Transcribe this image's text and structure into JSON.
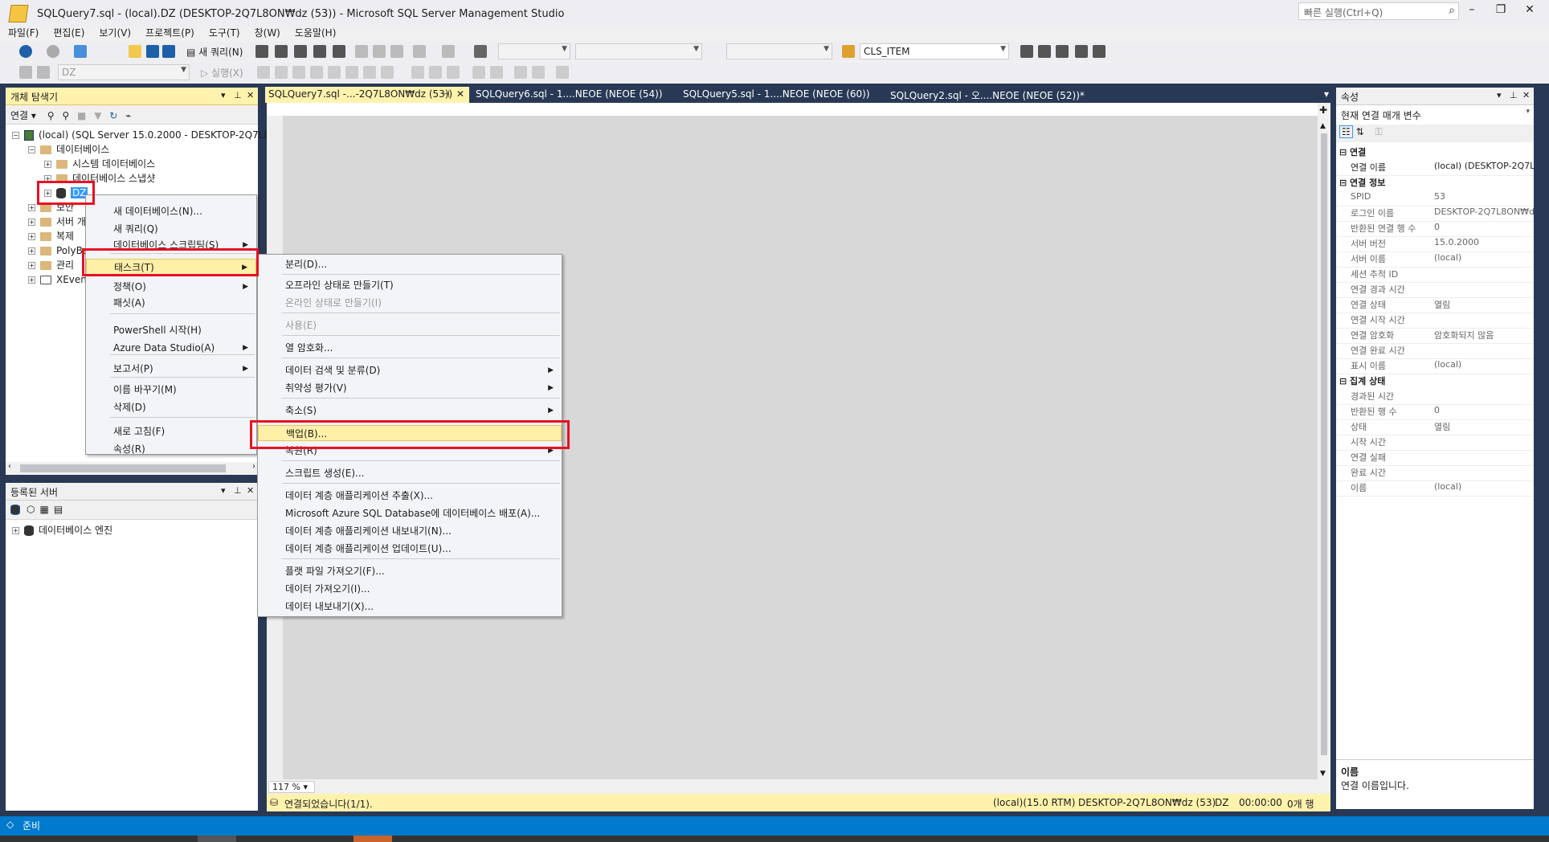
{
  "window": {
    "title": "SQLQuery7.sql - (local).DZ (DESKTOP-2Q7L8ON₩dz (53)) - Microsoft SQL Server Management Studio",
    "quick_launch": "빠른 실행(Ctrl+Q)"
  },
  "menubar": [
    "파일(F)",
    "편집(E)",
    "보기(V)",
    "프로젝트(P)",
    "도구(T)",
    "창(W)",
    "도움말(H)"
  ],
  "toolbar": {
    "new_query": "새 쿼리(N)",
    "db_combo": "DZ",
    "execute": "실행(X)",
    "find_combo": "CLS_ITEM"
  },
  "object_explorer": {
    "title": "개체 탐색기",
    "connect": "연결",
    "nodes": [
      {
        "label": "(local) (SQL Server 15.0.2000 - DESKTOP-2Q7L8C"
      },
      {
        "label": "데이터베이스"
      },
      {
        "label": "시스템 데이터베이스"
      },
      {
        "label": "데이터베이스 스냅샷"
      },
      {
        "label": "DZ"
      },
      {
        "label": "보안"
      },
      {
        "label": "서버 개체"
      },
      {
        "label": "복제"
      },
      {
        "label": "PolyBase"
      },
      {
        "label": "관리"
      },
      {
        "label": "XEvent 프로파일러"
      }
    ]
  },
  "registered_servers": {
    "title": "등록된 서버",
    "root": "데이터베이스 엔진"
  },
  "tabs": [
    "SQLQuery7.sql -...-2Q7L8ON₩dz (53))",
    "SQLQuery6.sql - 1....NEOE (NEOE (54))",
    "SQLQuery5.sql - 1....NEOE (NEOE (60))",
    "SQLQuery2.sql - 오....NEOE (NEOE (52))*"
  ],
  "context_menu": {
    "items": [
      "새 데이터베이스(N)...",
      "새 쿼리(Q)",
      "데이터베이스 스크립팅(S)",
      "태스크(T)",
      "정책(O)",
      "패싯(A)",
      "PowerShell 시작(H)",
      "Azure Data Studio(A)",
      "보고서(P)",
      "이름 바꾸기(M)",
      "삭제(D)",
      "새로 고침(F)",
      "속성(R)"
    ]
  },
  "tasks_menu": {
    "items": [
      "분리(D)...",
      "오프라인 상태로 만들기(T)",
      "온라인 상태로 만들기(I)",
      "사용(E)",
      "열 암호화...",
      "데이터 검색 및 분류(D)",
      "취약성 평가(V)",
      "축소(S)",
      "백업(B)...",
      "복원(R)",
      "스크립트 생성(E)...",
      "데이터 계층 애플리케이션 추출(X)...",
      "Microsoft Azure SQL Database에 데이터베이스 배포(A)...",
      "데이터 계층 애플리케이션 내보내기(N)...",
      "데이터 계층 애플리케이션 업데이트(U)...",
      "플랫 파일 가져오기(F)...",
      "데이터 가져오기(I)...",
      "데이터 내보내기(X)..."
    ]
  },
  "editor": {
    "zoom": "117 %"
  },
  "status": {
    "connected": "연결되었습니다(1/1).",
    "server": "(local)(15.0 RTM)",
    "user": "DESKTOP-2Q7L8ON₩dz (53)",
    "db": "DZ",
    "time": "00:00:00",
    "rows": "0개 행"
  },
  "properties": {
    "title": "속성",
    "combo": "현재 연결 매개 변수",
    "cat1": "연결",
    "cat2": "연결 정보",
    "cat3": "집계 상태",
    "rows1": [
      {
        "k": "연결 이름",
        "v": "(local) (DESKTOP-2Q7L"
      }
    ],
    "rows2": [
      {
        "k": "SPID",
        "v": "53"
      },
      {
        "k": "로그인 이름",
        "v": "DESKTOP-2Q7L8ON₩d"
      },
      {
        "k": "반환된 연결 행 수",
        "v": "0"
      },
      {
        "k": "서버 버전",
        "v": "15.0.2000"
      },
      {
        "k": "서버 이름",
        "v": "(local)"
      },
      {
        "k": "세션 추적 ID",
        "v": ""
      },
      {
        "k": "연결 경과 시간",
        "v": ""
      },
      {
        "k": "연결 상태",
        "v": "열림"
      },
      {
        "k": "연결 시작 시간",
        "v": ""
      },
      {
        "k": "연결 암호화",
        "v": "암호화되지 않음"
      },
      {
        "k": "연결 완료 시간",
        "v": ""
      },
      {
        "k": "표시 이름",
        "v": "(local)"
      }
    ],
    "rows3": [
      {
        "k": "경과된 시간",
        "v": ""
      },
      {
        "k": "반환된 행 수",
        "v": "0"
      },
      {
        "k": "상태",
        "v": "열림"
      },
      {
        "k": "시작 시간",
        "v": ""
      },
      {
        "k": "연결 실패",
        "v": ""
      },
      {
        "k": "완료 시간",
        "v": ""
      },
      {
        "k": "이름",
        "v": "(local)"
      }
    ],
    "desc_title": "이름",
    "desc_text": "연결 이름입니다."
  },
  "bottom_status": "준비"
}
